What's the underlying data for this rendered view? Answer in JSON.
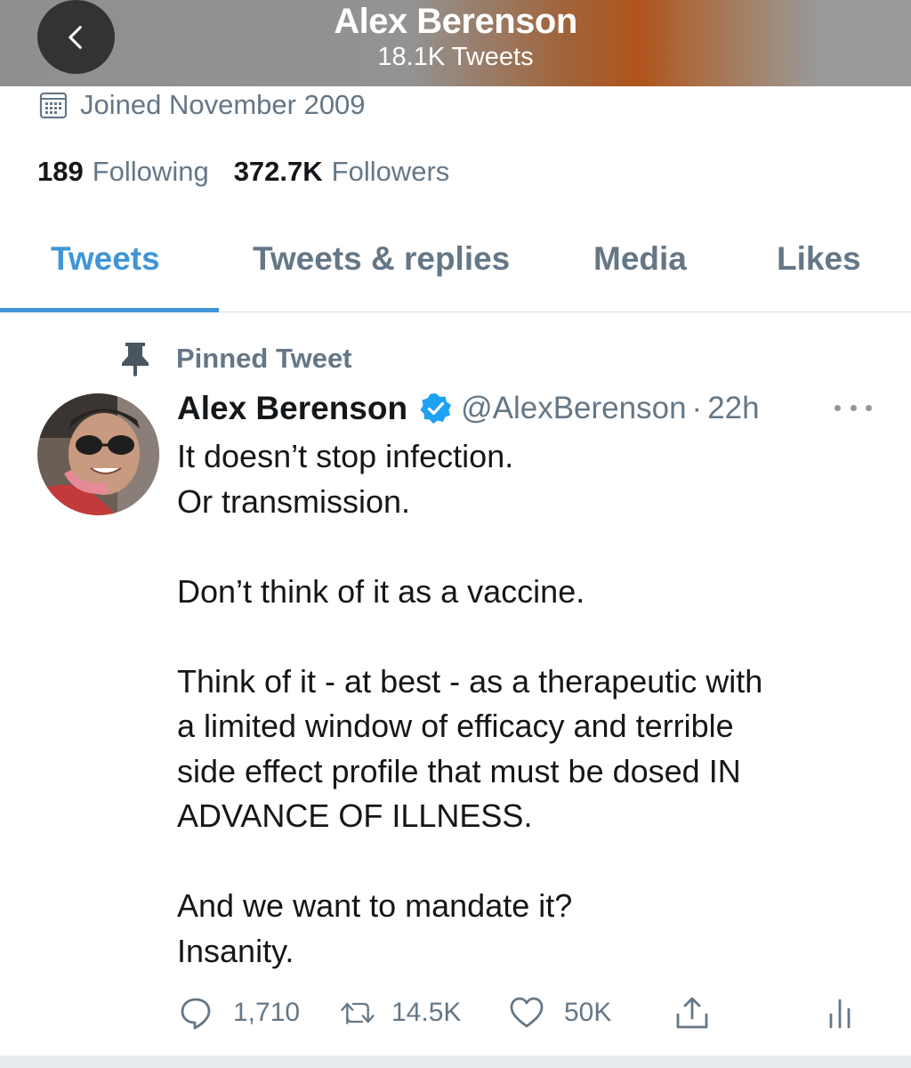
{
  "header": {
    "title": "Alex Berenson",
    "subtitle": "18.1K Tweets",
    "back_icon": "chevron-left-icon"
  },
  "profile": {
    "joined_icon": "calendar-icon",
    "joined": "Joined November 2009",
    "following_count": "189",
    "following_label": "Following",
    "followers_count": "372.7K",
    "followers_label": "Followers"
  },
  "tabs": [
    {
      "label": "Tweets",
      "active": true
    },
    {
      "label": "Tweets & replies",
      "active": false
    },
    {
      "label": "Media",
      "active": false
    },
    {
      "label": "Likes",
      "active": false
    }
  ],
  "tweet": {
    "pinned_icon": "pin-icon",
    "pinned_label": "Pinned Tweet",
    "author_name": "Alex Berenson",
    "verified": true,
    "handle": "@AlexBerenson",
    "separator": "·",
    "time": "22h",
    "more_icon": "more-icon",
    "body_lines": [
      "It doesn’t stop infection.",
      "Or transmission.",
      "",
      "Don’t think of it as a vaccine.",
      "",
      "Think of it - at best - as a therapeutic with",
      "a limited window of efficacy and terrible",
      "side effect profile that must be dosed IN",
      "ADVANCE OF ILLNESS.",
      "",
      "And we want to mandate it?",
      "Insanity."
    ],
    "actions": {
      "reply_count": "1,710",
      "retweet_count": "14.5K",
      "like_count": "50K"
    }
  },
  "colors": {
    "accent": "#3f95d8",
    "muted_text": "#657786",
    "primary_text": "#14171a",
    "verified_badge": "#1da1f2"
  }
}
